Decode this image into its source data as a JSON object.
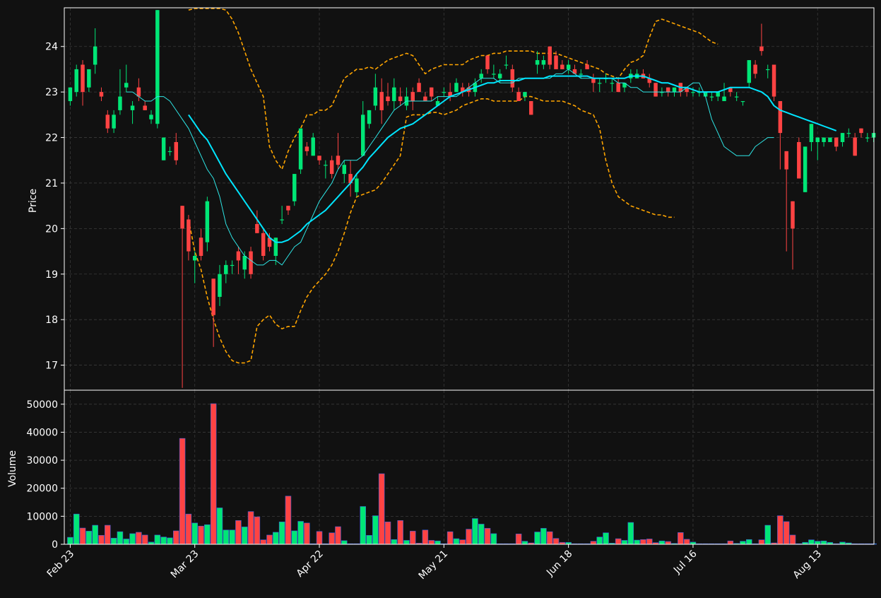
{
  "chart_data": {
    "type": "candlestick",
    "style": {
      "background": "#111111",
      "up_color": "#00E676",
      "down_color": "#FF4343",
      "sma_fast_color": "#2EE6E6",
      "sma_slow_color": "#00E5FF",
      "band_color": "#FFA500",
      "axis_color": "#FFFFFF",
      "grid": true
    },
    "price_panel": {
      "ylabel": "Price",
      "yticks": [
        "17",
        "18",
        "19",
        "20",
        "21",
        "22",
        "23",
        "24"
      ],
      "ylim": [
        16.45,
        24.85
      ]
    },
    "volume_panel": {
      "ylabel": "Volume",
      "yticks": [
        "0",
        "10000",
        "20000",
        "30000",
        "40000",
        "50000"
      ],
      "ylim": [
        0,
        55000
      ]
    },
    "x_tick_labels": [
      {
        "index": 0,
        "label": "Feb 23"
      },
      {
        "index": 20,
        "label": "Mar 23"
      },
      {
        "index": 40,
        "label": "Apr 22"
      },
      {
        "index": 60,
        "label": "May 21"
      },
      {
        "index": 80,
        "label": "Jun 18"
      },
      {
        "index": 100,
        "label": "Jul 16"
      },
      {
        "index": 120,
        "label": "Aug 13"
      }
    ],
    "candles": [
      [
        22.8,
        23.1,
        22.7,
        23.1,
        2500
      ],
      [
        23.0,
        23.6,
        22.9,
        23.5,
        10800
      ],
      [
        23.6,
        23.7,
        22.7,
        23.0,
        5800
      ],
      [
        23.1,
        23.5,
        23.0,
        23.5,
        4700
      ],
      [
        23.6,
        24.4,
        23.4,
        24.0,
        6800
      ],
      [
        23.0,
        23.1,
        22.8,
        22.9,
        3200
      ],
      [
        22.5,
        22.6,
        22.1,
        22.2,
        6800
      ],
      [
        22.2,
        22.6,
        22.1,
        22.5,
        2200
      ],
      [
        22.6,
        23.5,
        22.5,
        22.9,
        4500
      ],
      [
        23.1,
        23.6,
        23.0,
        23.2,
        1900
      ],
      [
        22.6,
        22.8,
        22.3,
        22.7,
        3800
      ],
      [
        23.1,
        23.3,
        22.8,
        22.9,
        4300
      ],
      [
        22.7,
        22.8,
        22.6,
        22.6,
        3300
      ],
      [
        22.4,
        22.6,
        22.3,
        22.5,
        800
      ],
      [
        22.3,
        24.8,
        22.2,
        24.8,
        3300
      ],
      [
        21.5,
        22.0,
        21.5,
        22.0,
        2600
      ],
      [
        21.7,
        21.8,
        21.6,
        21.7,
        2300
      ],
      [
        21.9,
        22.1,
        21.4,
        21.5,
        4800
      ],
      [
        20.5,
        20.5,
        16.5,
        20.0,
        37800
      ],
      [
        20.2,
        20.3,
        19.3,
        19.5,
        10800
      ],
      [
        19.3,
        19.5,
        18.8,
        19.4,
        7600
      ],
      [
        19.8,
        20.0,
        19.3,
        19.4,
        6500
      ],
      [
        19.7,
        20.7,
        19.5,
        20.6,
        7000
      ],
      [
        18.9,
        18.9,
        17.4,
        18.1,
        50200
      ],
      [
        18.5,
        19.2,
        18.3,
        19.0,
        13000
      ],
      [
        19.0,
        19.3,
        18.8,
        19.2,
        5100
      ],
      [
        19.2,
        19.3,
        19.0,
        19.2,
        5100
      ],
      [
        19.5,
        19.6,
        19.0,
        19.3,
        8500
      ],
      [
        19.1,
        19.5,
        18.9,
        19.4,
        6200
      ],
      [
        19.5,
        19.6,
        18.9,
        19.0,
        11700
      ],
      [
        20.1,
        20.4,
        19.9,
        19.9,
        9800
      ],
      [
        19.9,
        20.0,
        19.3,
        19.4,
        1600
      ],
      [
        19.8,
        19.9,
        19.5,
        19.6,
        3300
      ],
      [
        19.4,
        19.8,
        19.2,
        19.8,
        4300
      ],
      [
        20.2,
        20.5,
        20.1,
        20.2,
        8000
      ],
      [
        20.5,
        20.5,
        20.3,
        20.4,
        17200
      ],
      [
        20.6,
        21.2,
        20.5,
        21.2,
        4800
      ],
      [
        21.3,
        22.2,
        21.2,
        22.2,
        8200
      ],
      [
        21.8,
        21.9,
        21.6,
        21.7,
        7600
      ],
      [
        21.6,
        22.1,
        21.6,
        22.0,
        200
      ],
      [
        21.6,
        21.6,
        21.4,
        21.5,
        4600
      ],
      [
        21.4,
        21.5,
        21.1,
        21.4,
        200
      ],
      [
        21.5,
        21.6,
        21.1,
        21.2,
        4100
      ],
      [
        21.6,
        22.1,
        21.3,
        21.4,
        6300
      ],
      [
        21.2,
        21.5,
        21.0,
        21.4,
        1300
      ],
      [
        21.2,
        21.5,
        20.7,
        21.0,
        200
      ],
      [
        20.8,
        21.2,
        20.7,
        21.1,
        200
      ],
      [
        21.6,
        22.8,
        21.6,
        22.5,
        13500
      ],
      [
        22.3,
        22.6,
        22.2,
        22.6,
        3200
      ],
      [
        22.7,
        23.4,
        22.6,
        23.1,
        10200
      ],
      [
        23.0,
        23.3,
        22.3,
        22.6,
        25200
      ],
      [
        22.9,
        23.2,
        22.7,
        22.8,
        8000
      ],
      [
        22.8,
        23.3,
        22.6,
        23.1,
        1700
      ],
      [
        22.9,
        23.1,
        22.7,
        22.8,
        8500
      ],
      [
        22.7,
        23.1,
        22.6,
        22.9,
        1400
      ],
      [
        23.0,
        23.1,
        22.6,
        22.8,
        4700
      ],
      [
        23.2,
        23.3,
        23.0,
        23.0,
        400
      ],
      [
        22.9,
        23.0,
        22.8,
        22.8,
        5100
      ],
      [
        23.1,
        23.1,
        22.8,
        22.9,
        1400
      ],
      [
        22.7,
        22.9,
        22.7,
        22.8,
        1200
      ],
      [
        23.0,
        23.1,
        22.9,
        23.0,
        200
      ],
      [
        23.0,
        23.2,
        22.8,
        22.9,
        4500
      ],
      [
        23.0,
        23.3,
        23.0,
        23.2,
        2000
      ],
      [
        23.1,
        23.2,
        22.9,
        23.0,
        1600
      ],
      [
        23.1,
        23.2,
        22.9,
        23.0,
        5400
      ],
      [
        23.0,
        23.3,
        22.9,
        23.2,
        9200
      ],
      [
        23.3,
        23.5,
        23.2,
        23.4,
        7200
      ],
      [
        23.8,
        23.8,
        23.4,
        23.5,
        5700
      ],
      [
        23.4,
        23.6,
        23.3,
        23.4,
        3800
      ],
      [
        23.3,
        23.5,
        23.2,
        23.4,
        200
      ],
      [
        23.6,
        23.8,
        23.5,
        23.6,
        200
      ],
      [
        23.5,
        23.6,
        23.0,
        23.1,
        200
      ],
      [
        23.0,
        23.1,
        22.8,
        22.8,
        3700
      ],
      [
        22.9,
        23.0,
        22.8,
        23.0,
        1100
      ],
      [
        22.8,
        22.8,
        22.5,
        22.5,
        500
      ],
      [
        23.6,
        23.9,
        23.4,
        23.7,
        4400
      ],
      [
        23.6,
        23.8,
        23.5,
        23.7,
        5700
      ],
      [
        24.0,
        24.0,
        23.5,
        23.6,
        4500
      ],
      [
        23.8,
        23.9,
        23.5,
        23.5,
        2100
      ],
      [
        23.6,
        23.7,
        23.5,
        23.5,
        700
      ],
      [
        23.5,
        23.7,
        23.4,
        23.6,
        700
      ],
      [
        23.5,
        23.6,
        23.4,
        23.4,
        200
      ],
      [
        23.4,
        23.5,
        23.3,
        23.4,
        200
      ],
      [
        23.6,
        23.7,
        23.5,
        23.5,
        200
      ],
      [
        23.3,
        23.4,
        23.0,
        23.2,
        1100
      ],
      [
        23.2,
        23.3,
        23.0,
        23.2,
        2600
      ],
      [
        23.3,
        23.4,
        23.2,
        23.3,
        4100
      ],
      [
        23.2,
        23.3,
        23.0,
        23.2,
        400
      ],
      [
        23.2,
        23.3,
        23.0,
        23.0,
        2000
      ],
      [
        23.1,
        23.2,
        23.0,
        23.2,
        1400
      ],
      [
        23.3,
        23.5,
        23.2,
        23.4,
        7800
      ],
      [
        23.3,
        23.5,
        23.3,
        23.4,
        1500
      ],
      [
        23.4,
        23.5,
        23.3,
        23.3,
        1700
      ],
      [
        23.3,
        23.4,
        23.1,
        23.2,
        1900
      ],
      [
        23.2,
        23.2,
        22.9,
        22.9,
        600
      ],
      [
        23.0,
        23.1,
        22.9,
        23.0,
        1200
      ],
      [
        23.1,
        23.1,
        22.9,
        23.0,
        1000
      ],
      [
        23.0,
        23.1,
        22.9,
        23.1,
        300
      ],
      [
        23.2,
        23.2,
        22.9,
        23.0,
        4200
      ],
      [
        23.1,
        23.1,
        22.9,
        23.0,
        1800
      ],
      [
        23.0,
        23.1,
        22.9,
        23.0,
        800
      ],
      [
        23.0,
        23.1,
        22.9,
        23.0,
        200
      ],
      [
        22.9,
        23.0,
        22.9,
        23.0,
        200
      ],
      [
        22.9,
        23.0,
        22.8,
        22.9,
        200
      ],
      [
        22.9,
        23.0,
        22.8,
        23.0,
        200
      ],
      [
        22.8,
        23.2,
        22.8,
        22.9,
        200
      ],
      [
        23.1,
        23.1,
        22.9,
        23.0,
        1200
      ],
      [
        22.9,
        23.0,
        22.8,
        22.9,
        300
      ],
      [
        22.8,
        22.8,
        22.7,
        22.8,
        1100
      ],
      [
        23.2,
        23.7,
        23.1,
        23.7,
        1700
      ],
      [
        23.6,
        23.7,
        23.3,
        23.4,
        200
      ],
      [
        24.0,
        24.5,
        23.8,
        23.9,
        1600
      ],
      [
        23.5,
        23.6,
        23.3,
        23.5,
        6800
      ],
      [
        23.6,
        23.6,
        22.8,
        22.9,
        500
      ],
      [
        22.8,
        22.8,
        21.3,
        22.1,
        10200
      ],
      [
        21.7,
        21.7,
        19.5,
        21.3,
        8100
      ],
      [
        20.6,
        20.6,
        19.1,
        20.0,
        3300
      ],
      [
        21.9,
        22.0,
        21.2,
        21.1,
        200
      ],
      [
        20.8,
        21.8,
        20.8,
        21.8,
        700
      ],
      [
        21.9,
        22.3,
        21.7,
        22.3,
        1600
      ],
      [
        21.9,
        22.0,
        21.5,
        22.0,
        1100
      ],
      [
        21.9,
        22.0,
        21.8,
        22.0,
        1200
      ],
      [
        21.9,
        22.0,
        21.9,
        22.0,
        700
      ],
      [
        22.0,
        22.0,
        21.7,
        21.8,
        200
      ],
      [
        21.9,
        22.1,
        21.8,
        22.1,
        800
      ],
      [
        22.1,
        22.2,
        22.0,
        22.1,
        500
      ],
      [
        22.0,
        22.1,
        21.6,
        21.6,
        200
      ],
      [
        22.2,
        22.2,
        22.0,
        22.1,
        200
      ],
      [
        22.0,
        22.1,
        21.9,
        22.0,
        200
      ],
      [
        22.0,
        22.1,
        21.9,
        22.1,
        200
      ]
    ],
    "series": [
      {
        "name": "",
        "kind": "sma_fast",
        "start": 9,
        "values": [
          23.0,
          23.0,
          22.9,
          22.8,
          22.8,
          22.9,
          22.9,
          22.8,
          22.6,
          22.4,
          22.2,
          21.9,
          21.6,
          21.3,
          21.1,
          20.7,
          20.1,
          19.8,
          19.6,
          19.4,
          19.3,
          19.2,
          19.2,
          19.3,
          19.3,
          19.2,
          19.4,
          19.6,
          19.7,
          20.0,
          20.3,
          20.6,
          20.8,
          21.0,
          21.3,
          21.5,
          21.5,
          21.5,
          21.6,
          21.8,
          22.0,
          22.2,
          22.4,
          22.6,
          22.7,
          22.8,
          22.8,
          22.8,
          22.8,
          22.8,
          22.9,
          22.9,
          22.9,
          22.9,
          23.0,
          23.1,
          23.2,
          23.3,
          23.3,
          23.3,
          23.2,
          23.2,
          23.2,
          23.3,
          23.3,
          23.3,
          23.3,
          23.3,
          23.3,
          23.4,
          23.4,
          23.5,
          23.4,
          23.3,
          23.3,
          23.3,
          23.3,
          23.3,
          23.3,
          23.2,
          23.2,
          23.1,
          23.1,
          23.0,
          23.0,
          23.0,
          23.0,
          23.0,
          23.0,
          23.0,
          23.1,
          23.2,
          23.2,
          22.9,
          22.4,
          22.1,
          21.8,
          21.7,
          21.6,
          21.6,
          21.6,
          21.8,
          21.9,
          22.0,
          22.0
        ]
      },
      {
        "name": "",
        "kind": "sma_slow",
        "start": 19,
        "values": [
          22.5,
          22.3,
          22.1,
          21.95,
          21.7,
          21.45,
          21.2,
          21.0,
          20.8,
          20.6,
          20.4,
          20.2,
          20.0,
          19.8,
          19.7,
          19.7,
          19.75,
          19.85,
          19.95,
          20.1,
          20.2,
          20.3,
          20.4,
          20.55,
          20.7,
          20.85,
          21.0,
          21.2,
          21.35,
          21.55,
          21.7,
          21.85,
          22.0,
          22.1,
          22.2,
          22.25,
          22.3,
          22.4,
          22.5,
          22.6,
          22.7,
          22.8,
          22.9,
          22.95,
          23.0,
          23.05,
          23.1,
          23.15,
          23.2,
          23.2,
          23.25,
          23.25,
          23.25,
          23.25,
          23.3,
          23.3,
          23.3,
          23.3,
          23.35,
          23.35,
          23.35,
          23.35,
          23.35,
          23.35,
          23.35,
          23.3,
          23.3,
          23.3,
          23.3,
          23.3,
          23.3,
          23.35,
          23.35,
          23.35,
          23.3,
          23.25,
          23.2,
          23.2,
          23.15,
          23.1,
          23.1,
          23.05,
          23.0,
          23.0,
          23.0,
          23.0,
          23.05,
          23.1,
          23.1,
          23.1,
          23.1,
          23.05,
          23.0,
          22.9,
          22.7,
          22.6,
          22.55,
          22.5,
          22.45,
          22.4,
          22.35,
          22.3,
          22.25,
          22.2,
          22.15
        ]
      },
      {
        "name": "",
        "kind": "band_upper",
        "start": 19,
        "values": [
          24.8,
          25.0,
          25.1,
          25.0,
          24.95,
          24.9,
          24.8,
          24.6,
          24.3,
          23.9,
          23.5,
          23.2,
          22.9,
          21.8,
          21.5,
          21.3,
          21.7,
          22.0,
          22.2,
          22.5,
          22.5,
          22.6,
          22.6,
          22.7,
          23.0,
          23.3,
          23.4,
          23.5,
          23.5,
          23.55,
          23.5,
          23.6,
          23.7,
          23.75,
          23.8,
          23.85,
          23.8,
          23.6,
          23.4,
          23.5,
          23.55,
          23.6,
          23.6,
          23.6,
          23.6,
          23.7,
          23.75,
          23.8,
          23.8,
          23.85,
          23.85,
          23.9,
          23.9,
          23.9,
          23.9,
          23.9,
          23.85,
          23.85,
          23.85,
          23.85,
          23.8,
          23.75,
          23.7,
          23.65,
          23.6,
          23.55,
          23.5,
          23.4,
          23.35,
          23.3,
          23.5,
          23.65,
          23.7,
          23.8,
          24.2,
          24.55,
          24.6,
          24.55,
          24.5,
          24.45,
          24.4,
          24.35,
          24.3,
          24.2,
          24.1,
          24.05
        ]
      },
      {
        "name": "",
        "kind": "band_lower",
        "start": 19,
        "values": [
          20.2,
          19.5,
          19.1,
          18.5,
          18.0,
          17.6,
          17.3,
          17.1,
          17.05,
          17.05,
          17.1,
          17.85,
          18.0,
          18.1,
          17.9,
          17.8,
          17.85,
          17.85,
          18.2,
          18.5,
          18.7,
          18.85,
          19.0,
          19.2,
          19.5,
          19.9,
          20.35,
          20.7,
          20.75,
          20.8,
          20.85,
          21.0,
          21.2,
          21.4,
          21.6,
          22.45,
          22.5,
          22.5,
          22.5,
          22.55,
          22.55,
          22.5,
          22.55,
          22.6,
          22.7,
          22.75,
          22.8,
          22.85,
          22.85,
          22.8,
          22.8,
          22.8,
          22.8,
          22.8,
          22.9,
          22.9,
          22.85,
          22.8,
          22.8,
          22.8,
          22.8,
          22.75,
          22.7,
          22.6,
          22.55,
          22.5,
          22.2,
          21.5,
          21.0,
          20.7,
          20.6,
          20.5,
          20.45,
          20.4,
          20.35,
          20.3,
          20.3,
          20.25,
          20.25
        ]
      }
    ]
  }
}
